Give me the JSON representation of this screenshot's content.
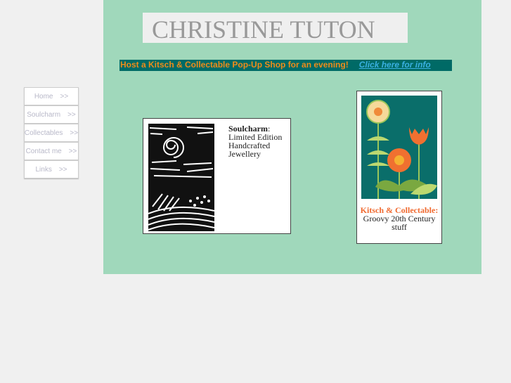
{
  "header": {
    "title": "CHRISTINE TUTON"
  },
  "banner": {
    "message": "Host a Kitsch & Collectable Pop-Up Shop for an evening!",
    "link": "Click here for info"
  },
  "nav": {
    "items": [
      {
        "label": "Home",
        "arrow": ">>"
      },
      {
        "label": "Soulcharm",
        "arrow": ">>"
      },
      {
        "label": "Collectables",
        "arrow": ">>"
      },
      {
        "label": "Contact me",
        "arrow": ">>"
      },
      {
        "label": "Links",
        "arrow": ">>"
      }
    ]
  },
  "soulcharm": {
    "name": "Soulcharm",
    "colon": ":",
    "line1": "Limited Edition",
    "line2": "Handcrafted",
    "line3": "Jewellery"
  },
  "kitsch": {
    "name": "Kitsch & Collectable:",
    "line1": "Groovy 20th Century",
    "line2": "stuff"
  },
  "colors": {
    "panel": "#a0d8bb",
    "banner": "#006a66",
    "accent": "#f08c1a",
    "link": "#3aafe0"
  }
}
